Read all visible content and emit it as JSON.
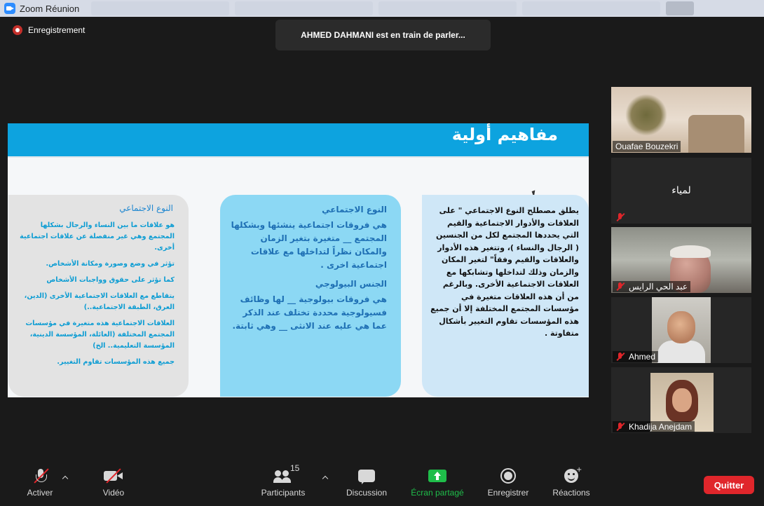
{
  "window": {
    "title": "Zoom Réunion",
    "accent_blue": "#2d8cff"
  },
  "recording": {
    "label": "Enregistrement",
    "icon": "recording-dot-icon"
  },
  "speaker_notice": "AHMED DAHMANI est en train de parler...",
  "slide": {
    "title": "مفاهيم أولية",
    "banner_color": "#0da3df",
    "left_card": {
      "title": "النوع الاجتماعي",
      "paragraphs": [
        "هو علاقات ما بين النساء والرجال بشكلها المجتمع وهي غير منفصلة عن علاقات اجتماعية أخرى.",
        "تؤثر في وضع وصورة ومكانة الأشخاص.",
        "كما تؤثر على حقوق وواجبات الأشخاص",
        "يتقاطع مع العلاقات الاجتماعية الأخرى (الدين، العرق، الطبقة الاجتماعية..)",
        "العلاقات الاجتماعية هذه متغيرة في مؤسسات المجتمع المختلفة (العائلة، المؤسسة الدينية، المؤسسة التعليمية.. الخ)",
        "جميع هذه المؤسسات تقاوم التغيير."
      ]
    },
    "middle_card": {
      "heading_1": "النوع الاجتماعي",
      "body_1": "هي فروقات اجتماعية ينشئها وبشكلها المجتمع __ متغيرة بتغير الزمان والمكان نظراً لتداخلها مع علاقات اجتماعية اخرى .",
      "heading_2": "الجنس البيولوجي",
      "body_2": "هي فروقات بيولوجية __ لها وظائف فسيولوجية محددة تختلف عند الذكر عما هي عليه عند الانثى __ وهي ثابتة."
    },
    "right_card": {
      "body": "يطلق مصطلح النوع الاجتماعي \" على العلاقات والأدوار الاجتماعية والقيم التي يحددها المجتمع لكل من الجنسين ( الرجال والنساء )، وتتغير هذه الأدوار والعلاقات والقيم وفقاً\" لتغير المكان والزمان وذلك لتداخلها وتشابكها مع العلاقات الاجتماعية الأخرى. وبالرغم من أن هذه العلاقات متغيرة في مؤسسات المجتمع المختلفة إلا أن جميع هذه المؤسسات تقاوم التغيير بأشكال متفاوتة ."
    }
  },
  "participants": [
    {
      "name": "Ouafae Bouzekri",
      "muted": false,
      "video": true
    },
    {
      "name": "لمياء",
      "muted": true,
      "video": false
    },
    {
      "name": "عبد الحي الرايس",
      "muted": true,
      "video": true
    },
    {
      "name": "Ahmed",
      "muted": true,
      "video": true
    },
    {
      "name": "Khadija Anejdam",
      "muted": true,
      "video": true
    }
  ],
  "toolbar": {
    "mute_label": "Activer",
    "video_label": "Vidéo",
    "participants_label": "Participants",
    "participants_count": "15",
    "chat_label": "Discussion",
    "share_label": "Écran partagé",
    "record_label": "Enregistrer",
    "reactions_label": "Réactions",
    "quit_label": "Quitter",
    "share_color": "#1fbd4a",
    "quit_color": "#e0262b"
  }
}
